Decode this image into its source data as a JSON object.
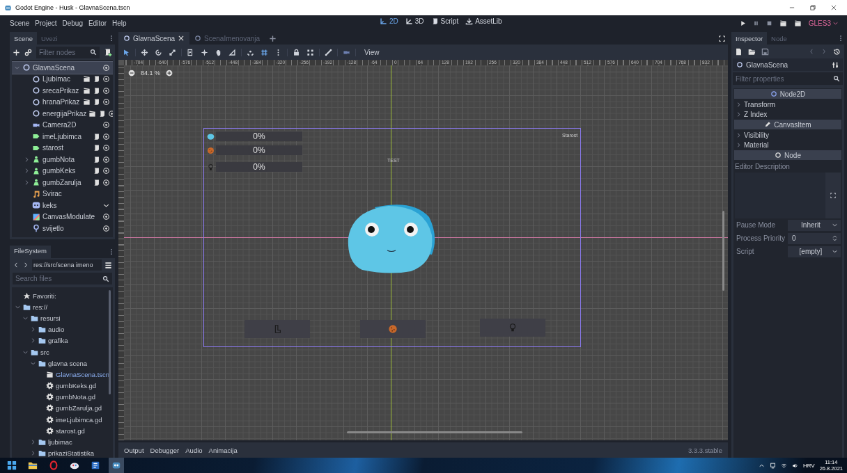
{
  "window": {
    "title": "Godot Engine - Husk - GlavnaScena.tscn"
  },
  "menu": [
    "Scene",
    "Project",
    "Debug",
    "Editor",
    "Help"
  ],
  "workspaces": [
    {
      "kind": "canvas",
      "label": "2D",
      "selected": true
    },
    {
      "kind": "spatial",
      "label": "3D",
      "selected": false
    },
    {
      "kind": "script",
      "label": "Script",
      "selected": false
    },
    {
      "kind": "assetlib",
      "label": "AssetLib",
      "selected": false
    }
  ],
  "renderer": "GLES3",
  "scene_dock": {
    "tabs": [
      {
        "label": "Scene",
        "selected": true
      },
      {
        "label": "Uvezi",
        "selected": false
      }
    ],
    "filter_placeholder": "Filter nodes",
    "tree": [
      {
        "name": "GlavnaScena",
        "kind": "node2d",
        "selected": true,
        "expanded": true,
        "buttons": [
          {
            "kind": "eye"
          }
        ],
        "children": [
          {
            "name": "Ljubimac",
            "kind": "node2d",
            "selected": false,
            "buttons": [
              {
                "kind": "instance"
              },
              {
                "kind": "script"
              },
              {
                "kind": "eye"
              }
            ]
          },
          {
            "name": "srecaPrikaz",
            "kind": "node2d",
            "selected": false,
            "buttons": [
              {
                "kind": "instance"
              },
              {
                "kind": "script"
              },
              {
                "kind": "eye"
              }
            ]
          },
          {
            "name": "hranaPrikaz",
            "kind": "node2d",
            "selected": false,
            "buttons": [
              {
                "kind": "instance"
              },
              {
                "kind": "script"
              },
              {
                "kind": "eye"
              }
            ]
          },
          {
            "name": "energijaPrikaz",
            "kind": "node2d",
            "selected": false,
            "buttons": [
              {
                "kind": "instance"
              },
              {
                "kind": "script"
              },
              {
                "kind": "eye"
              }
            ]
          },
          {
            "name": "Camera2D",
            "kind": "camera",
            "selected": false,
            "buttons": [
              {
                "kind": "eye"
              }
            ]
          },
          {
            "name": "imeLjubimca",
            "kind": "label",
            "selected": false,
            "buttons": [
              {
                "kind": "script"
              },
              {
                "kind": "eye"
              }
            ]
          },
          {
            "name": "starost",
            "kind": "label",
            "selected": false,
            "buttons": [
              {
                "kind": "script"
              },
              {
                "kind": "eye"
              }
            ]
          },
          {
            "name": "gumbNota",
            "kind": "button",
            "selected": false,
            "expanded": false,
            "buttons": [
              {
                "kind": "script"
              },
              {
                "kind": "eye"
              }
            ]
          },
          {
            "name": "gumbKeks",
            "kind": "button",
            "selected": false,
            "expanded": false,
            "buttons": [
              {
                "kind": "script"
              },
              {
                "kind": "eye"
              }
            ]
          },
          {
            "name": "gumbZarulja",
            "kind": "button",
            "selected": false,
            "expanded": false,
            "buttons": [
              {
                "kind": "script"
              },
              {
                "kind": "eye"
              }
            ]
          },
          {
            "name": "Svirac",
            "kind": "audio",
            "selected": false
          },
          {
            "name": "keks",
            "kind": "sprite",
            "selected": false,
            "buttons": [
              {
                "kind": "chevron"
              }
            ]
          },
          {
            "name": "CanvasModulate",
            "kind": "modulate",
            "selected": false,
            "buttons": [
              {
                "kind": "eye"
              }
            ]
          },
          {
            "name": "svijetlo",
            "kind": "light",
            "selected": false,
            "buttons": [
              {
                "kind": "eye"
              }
            ]
          }
        ]
      }
    ]
  },
  "filesystem": {
    "tab": "FileSystem",
    "path": "res://src/scena imeno",
    "search_placeholder": "Search files",
    "tree": [
      {
        "label": "Favoriti:",
        "kind": "favorites",
        "selected": false
      },
      {
        "label": "res://",
        "kind": "folder",
        "selected": false,
        "expanded": true,
        "children": [
          {
            "label": "resursi",
            "kind": "folder",
            "selected": false,
            "expanded": true,
            "children": [
              {
                "label": "audio",
                "kind": "folder",
                "selected": false,
                "expanded": false
              },
              {
                "label": "grafika",
                "kind": "folder",
                "selected": false,
                "expanded": false
              }
            ]
          },
          {
            "label": "src",
            "kind": "folder",
            "selected": false,
            "expanded": true,
            "children": [
              {
                "label": "glavna scena",
                "kind": "folder",
                "selected": false,
                "expanded": true,
                "children": [
                  {
                    "label": "GlavnaScena.tscn",
                    "kind": "scene",
                    "selected": true
                  },
                  {
                    "label": "gumbKeks.gd",
                    "kind": "script",
                    "selected": false
                  },
                  {
                    "label": "gumbNota.gd",
                    "kind": "script",
                    "selected": false
                  },
                  {
                    "label": "gumbZarulja.gd",
                    "kind": "script",
                    "selected": false
                  },
                  {
                    "label": "imeLjubimca.gd",
                    "kind": "script",
                    "selected": false
                  },
                  {
                    "label": "starost.gd",
                    "kind": "script",
                    "selected": false
                  }
                ]
              },
              {
                "label": "ljubimac",
                "kind": "folder",
                "selected": false,
                "expanded": false
              },
              {
                "label": "prikaziStatistika",
                "kind": "folder",
                "selected": false,
                "expanded": false
              }
            ]
          }
        ]
      }
    ]
  },
  "editor": {
    "tabs": [
      {
        "label": "GlavnaScena",
        "selected": true,
        "closable": true
      },
      {
        "label": "ScenaImenovanja",
        "selected": false,
        "closable": false
      }
    ],
    "tool_groups": [
      [
        {
          "kind": "select",
          "active": true
        }
      ],
      [
        {
          "kind": "move",
          "active": false
        },
        {
          "kind": "rotate",
          "active": false
        },
        {
          "kind": "scale",
          "active": false
        }
      ],
      [
        {
          "kind": "list",
          "active": false
        },
        {
          "kind": "pivot",
          "active": false
        },
        {
          "kind": "pan",
          "active": false
        },
        {
          "kind": "ruler",
          "active": false
        }
      ],
      [
        {
          "kind": "smart-snap",
          "active": false
        },
        {
          "kind": "grid-snap",
          "active": true
        },
        {
          "kind": "more",
          "active": false
        }
      ],
      [
        {
          "kind": "lock",
          "active": false
        },
        {
          "kind": "group",
          "active": false
        }
      ],
      [
        {
          "kind": "bone",
          "active": false
        }
      ],
      [
        {
          "kind": "camera-override",
          "active": false
        }
      ]
    ],
    "view_menu": "View",
    "zoom": "84.1 %",
    "ruler_labels": [
      "-704",
      "-640",
      "-576",
      "-512",
      "-448",
      "-384",
      "-320",
      "-256",
      "-192",
      "-128",
      "-64",
      "0",
      "64",
      "128",
      "192",
      "256",
      "320",
      "384",
      "448",
      "512",
      "576",
      "640",
      "704",
      "768",
      "832"
    ],
    "game_scene": {
      "stat_bars": [
        {
          "kind": "creature",
          "reading": "0%",
          "level": 0
        },
        {
          "kind": "cookie",
          "reading": "0%",
          "level": 0
        },
        {
          "kind": "bulb",
          "reading": "0%",
          "level": 0
        }
      ],
      "age_label": "Starost",
      "test_label": "TEST",
      "action_buttons": [
        {
          "kind": "boot"
        },
        {
          "kind": "cookie"
        },
        {
          "kind": "bulb"
        }
      ]
    },
    "bottom_tabs": [
      "Output",
      "Debugger",
      "Audio",
      "Animacija"
    ],
    "version": "3.3.3.stable"
  },
  "inspector": {
    "tabs": [
      {
        "label": "Inspector",
        "selected": true
      },
      {
        "label": "Node",
        "selected": false
      }
    ],
    "object": {
      "kind": "node2d",
      "name": "GlavnaScena"
    },
    "filter_placeholder": "Filter properties",
    "rows": [
      {
        "kind": "category",
        "label": "Node2D"
      },
      {
        "kind": "section",
        "label": "Transform",
        "expanded": false
      },
      {
        "kind": "section",
        "label": "Z Index",
        "expanded": false
      },
      {
        "kind": "category",
        "label": "CanvasItem"
      },
      {
        "kind": "section",
        "label": "Visibility",
        "expanded": false
      },
      {
        "kind": "section",
        "label": "Material",
        "expanded": false
      },
      {
        "kind": "category",
        "label": "Node"
      },
      {
        "kind": "textarea",
        "label": "Editor Description"
      },
      {
        "kind": "dropdown",
        "label": "Pause Mode",
        "value": "Inherit"
      },
      {
        "kind": "spin",
        "label": "Process Priority",
        "value": "0"
      },
      {
        "kind": "dropdown",
        "label": "Script",
        "value": "[empty]"
      }
    ]
  },
  "taskbar": {
    "apps": [
      {
        "kind": "start",
        "selected": false
      },
      {
        "kind": "explorer",
        "selected": false
      },
      {
        "kind": "opera",
        "selected": false
      },
      {
        "kind": "paint",
        "selected": false
      },
      {
        "kind": "word",
        "selected": false
      },
      {
        "kind": "godot",
        "selected": true
      }
    ],
    "language": "HRV",
    "time": "11:14",
    "date": "26.8.2021"
  }
}
